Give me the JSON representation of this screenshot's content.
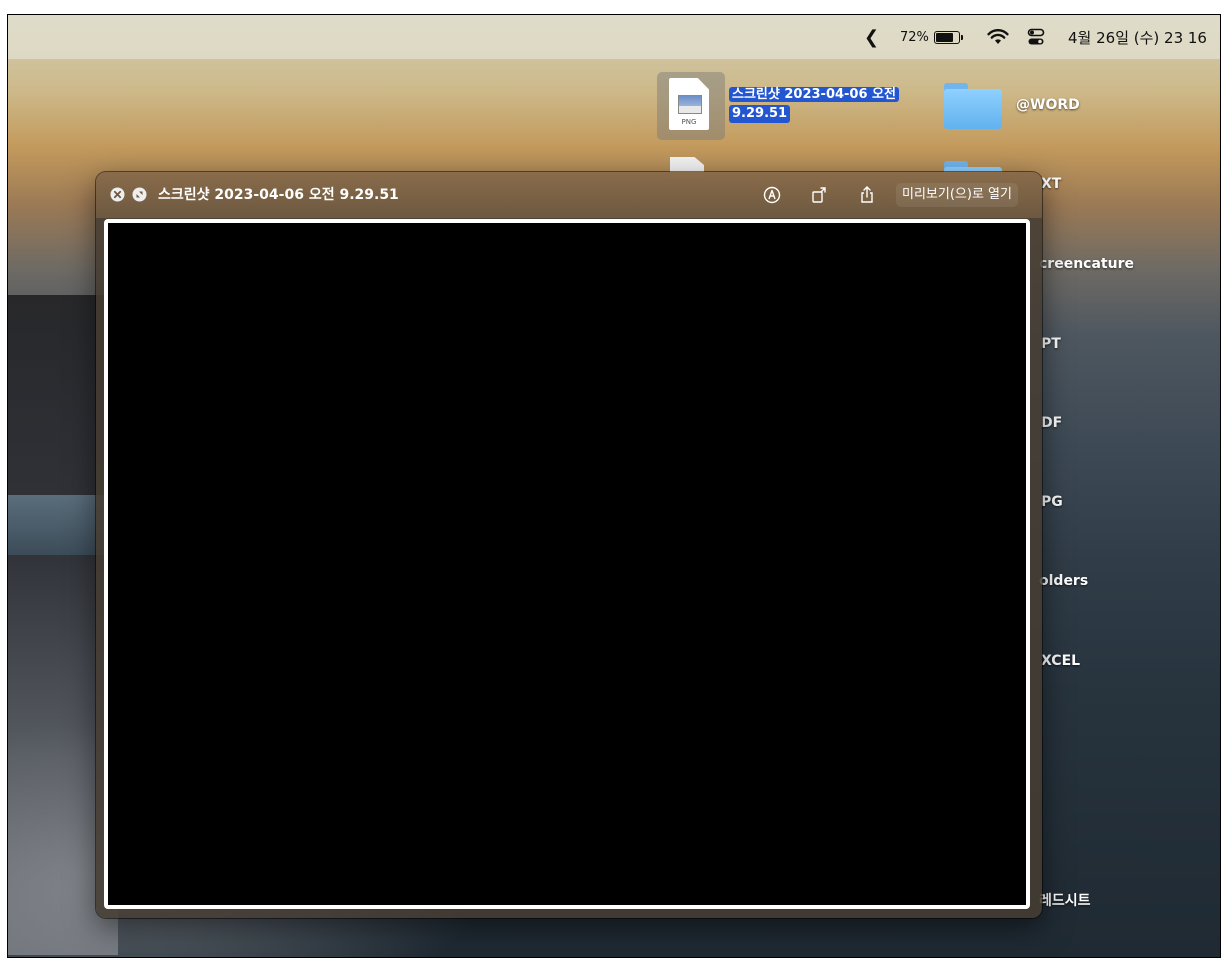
{
  "menubar": {
    "chevron": "❮",
    "battery_percent": "72%",
    "clock": "4월 26일 (수) 23 16"
  },
  "desktop": {
    "file": {
      "label_line1": "스크린샷 2023-04-06 오전",
      "label_line2": "9.29.51",
      "extension": "PNG"
    },
    "labels": {
      "word": "@WORD",
      "txt": "XT",
      "screencature": "creencature",
      "pt": "PT",
      "df": "DF",
      "pg": "PG",
      "folders": "olders",
      "cel": "XCEL",
      "sheet": "레드시트"
    }
  },
  "quicklook": {
    "title": "스크린샷 2023-04-06 오전 9.29.51",
    "open_button": "미리보기(으)로 열기"
  }
}
